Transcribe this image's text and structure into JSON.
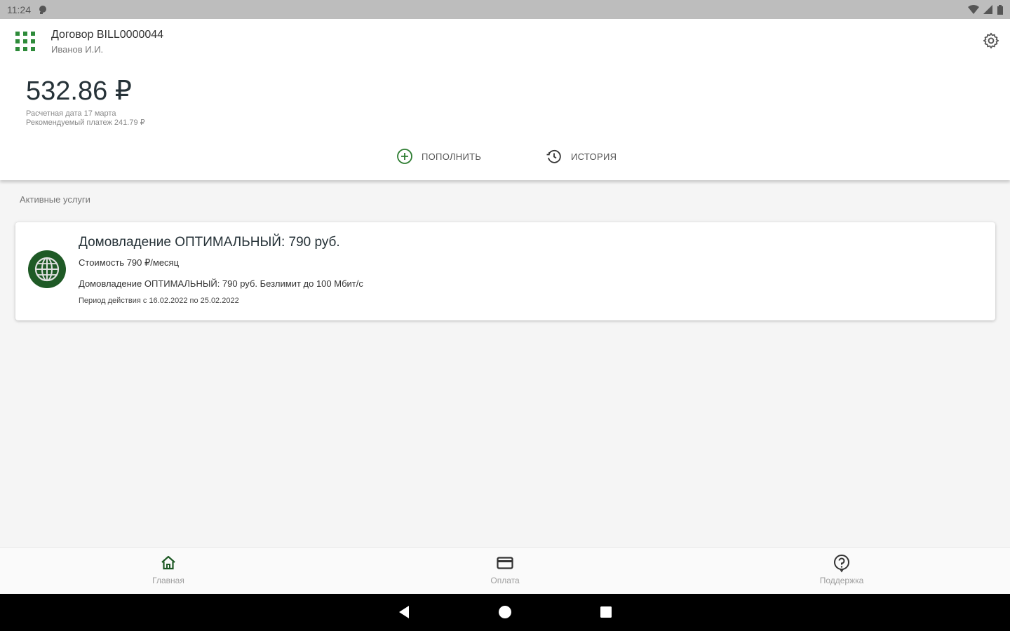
{
  "status_bar": {
    "time": "11:24"
  },
  "header": {
    "contract_title": "Договор BILL0000044",
    "contract_user": "Иванов И.И.",
    "balance": "532.86 ₽",
    "settlement_date": "Расчетная дата 17 марта",
    "recommended_payment": "Рекомендуемый платеж 241.79 ₽",
    "actions": {
      "topup": "ПОПОЛНИТЬ",
      "history": "ИСТОРИЯ"
    }
  },
  "services": {
    "section_label": "Активные услуги",
    "items": [
      {
        "title": "Домовладение ОПТИМАЛЬНЫЙ: 790 руб.",
        "price": "Стоимость 790 ₽/месяц",
        "description": "Домовладение ОПТИМАЛЬНЫЙ: 790 руб. Безлимит до 100 Мбит/с",
        "period": "Период действия с 16.02.2022 по 25.02.2022"
      }
    ]
  },
  "bottom_nav": {
    "home": "Главная",
    "payment": "Оплата",
    "support": "Поддержка"
  },
  "colors": {
    "accent": "#2e8b3a",
    "active_nav": "#1f5a26",
    "inactive_nav": "#9e9e9e"
  }
}
